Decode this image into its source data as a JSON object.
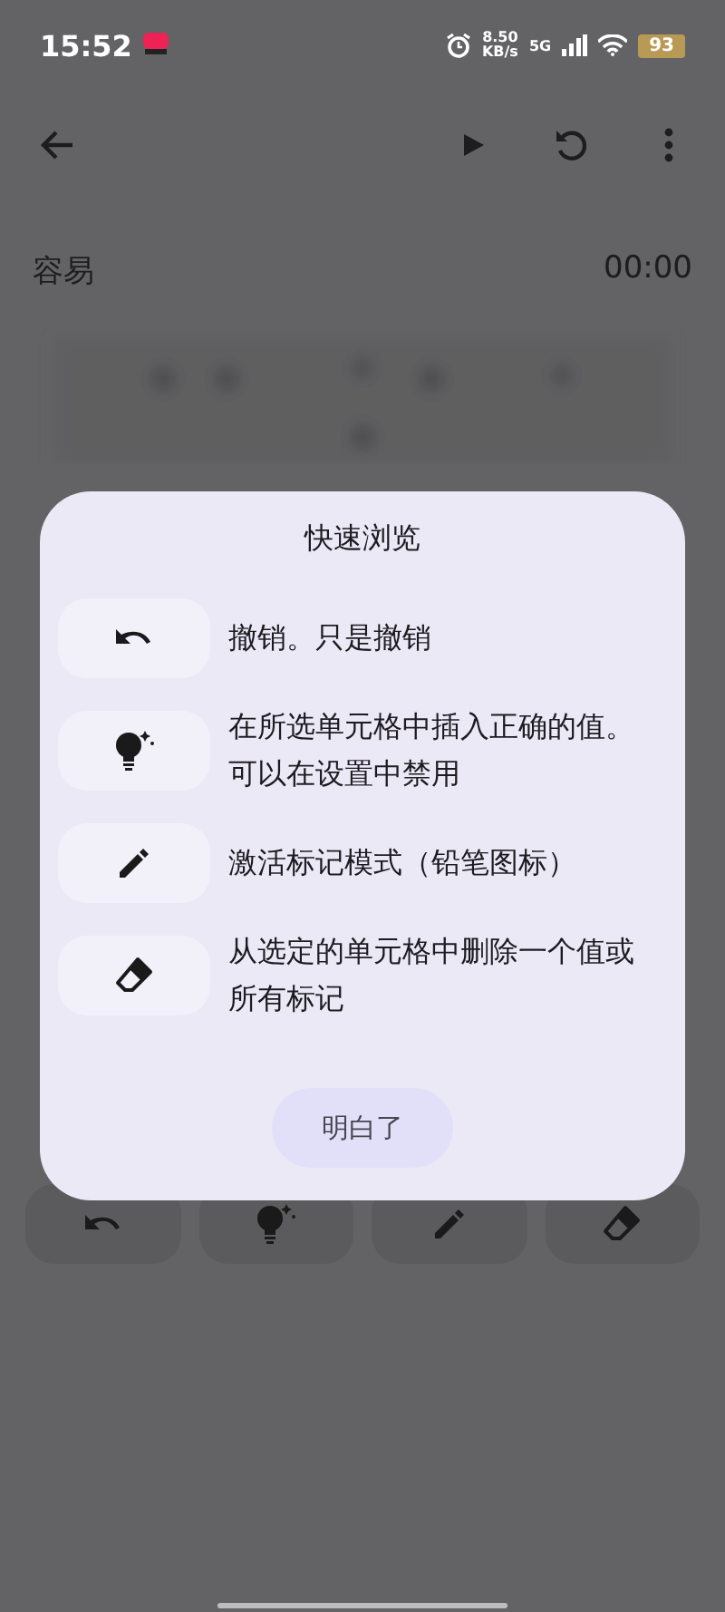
{
  "status_bar": {
    "time": "15:52",
    "speed_value": "8.50",
    "speed_unit": "KB/s",
    "network": "5G",
    "battery": "93"
  },
  "header": {
    "difficulty": "容易",
    "timer": "00:00"
  },
  "tools": [
    {
      "kind": "undo"
    },
    {
      "kind": "hint"
    },
    {
      "kind": "pencil"
    },
    {
      "kind": "eraser"
    }
  ],
  "dialog": {
    "title": "快速浏览",
    "items": [
      {
        "kind": "undo",
        "text": "撤销。只是撤销"
      },
      {
        "kind": "hint",
        "text": "在所选单元格中插入正确的值。可以在设置中禁用"
      },
      {
        "kind": "pencil",
        "text": "激活标记模式（铅笔图标）"
      },
      {
        "kind": "eraser",
        "text": "从选定的单元格中删除一个值或所有标记"
      }
    ],
    "button": "明白了"
  }
}
